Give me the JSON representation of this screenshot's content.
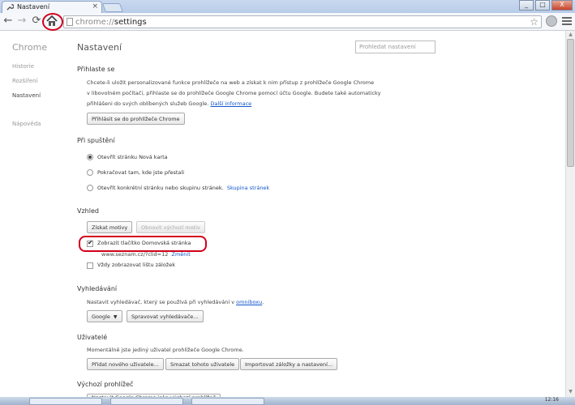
{
  "window": {
    "tab_title": "Nastavení",
    "tab_close": "×",
    "btn_min": "_",
    "btn_max": "□",
    "btn_close": "X"
  },
  "toolbar": {
    "url_scheme": "chrome://",
    "url_path": "settings"
  },
  "left_nav": {
    "brand": "Chrome",
    "items": [
      "Historie",
      "Rozšíření",
      "Nastavení",
      "Nápověda"
    ],
    "selected": "Nastavení"
  },
  "page": {
    "title": "Nastavení",
    "search_placeholder": "Prohledat nastavení"
  },
  "signin": {
    "heading": "Přihlaste se",
    "line1": "Chcete-li uložit personalizované funkce prohlížeče na web a získat k nim přístup z prohlížeče Google Chrome",
    "line2": "v libovolném počítači, přihlaste se do prohlížeče Google Chrome pomocí účtu Google. Budete také automaticky",
    "line3": "přihlášeni do svých oblíbených služeb Google.",
    "more_link": "Další informace",
    "button": "Přihlásit se do prohlížeče Chrome"
  },
  "startup": {
    "heading": "Při spuštění",
    "options": [
      {
        "label": "Otevřít stránku Nová karta",
        "checked": true
      },
      {
        "label": "Pokračovat tam, kde jste přestali",
        "checked": false
      },
      {
        "label": "Otevřít konkrétní stránku nebo skupinu stránek.",
        "checked": false
      }
    ],
    "set_pages_link": "Skupina stránek"
  },
  "appearance": {
    "heading": "Vzhled",
    "get_themes": "Získat motivy",
    "reset_theme": "Obnovit výchozí motiv",
    "show_home": "Zobrazit tlačítko Domovská stránka",
    "show_home_checked": true,
    "home_url": "www.seznam.cz/?clid=12",
    "change_link": "Změnit",
    "show_bookmarks": "Vždy zobrazovat lištu záložek",
    "show_bookmarks_checked": false
  },
  "search": {
    "heading": "Vyhledávání",
    "desc": "Nastavit vyhledávač, který se používá při vyhledávání v",
    "omnibox_link": "omniboxu",
    "engine": "Google",
    "manage": "Spravovat vyhledávače..."
  },
  "users": {
    "heading": "Uživatelé",
    "desc": "Momentálně jste jediný uživatel prohlížeče Google Chrome.",
    "add": "Přidat nového uživatele...",
    "delete": "Smazat tohoto uživatele",
    "import": "Importovat záložky a nastavení..."
  },
  "default_browser": {
    "heading": "Výchozí prohlížeč",
    "button": "Nastavit Google Chrome jako výchozí prohlížeč"
  },
  "taskbar": {
    "clock": "12:16"
  },
  "colors": {
    "annotation_red": "#d3001a",
    "link_blue": "#1155cc"
  }
}
